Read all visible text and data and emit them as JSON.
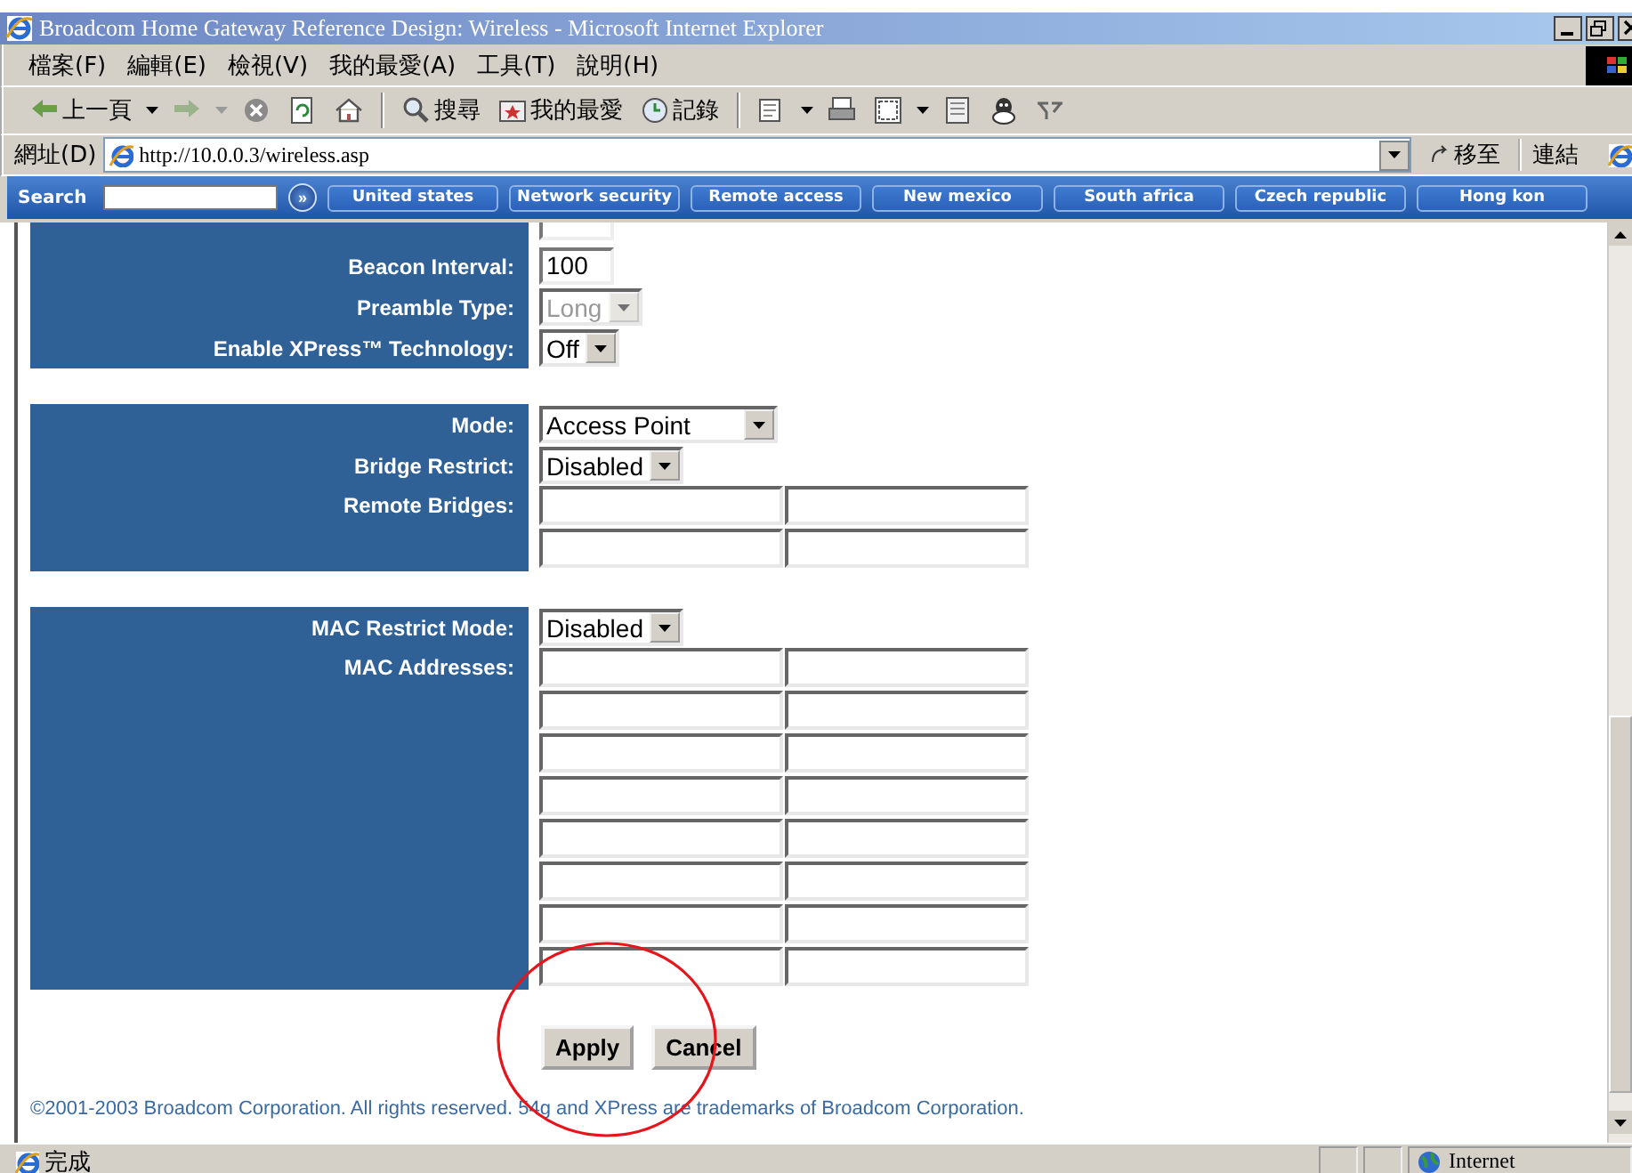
{
  "window": {
    "title": "Broadcom Home Gateway Reference Design: Wireless - Microsoft Internet Explorer"
  },
  "menu": [
    "檔案(F)",
    "編輯(E)",
    "檢視(V)",
    "我的最愛(A)",
    "工具(T)",
    "說明(H)"
  ],
  "toolbar": [
    {
      "kind": "back",
      "label": "上一頁"
    },
    {
      "kind": "forward"
    },
    {
      "kind": "stop"
    },
    {
      "kind": "refresh"
    },
    {
      "kind": "home"
    },
    {
      "kind": "search",
      "label": "搜尋"
    },
    {
      "kind": "favorites",
      "label": "我的最愛"
    },
    {
      "kind": "history",
      "label": "記錄"
    },
    {
      "kind": "mail"
    },
    {
      "kind": "print"
    },
    {
      "kind": "edit"
    },
    {
      "kind": "discuss"
    },
    {
      "kind": "messenger"
    },
    {
      "kind": "yahoo"
    }
  ],
  "address_bar": {
    "label": "網址(D)",
    "url": "http://10.0.0.3/wireless.asp",
    "go": "移至",
    "links": "連結"
  },
  "search_bar": {
    "label": "Search",
    "go": "»",
    "links": [
      "United states",
      "Network security",
      "Remote access",
      "New mexico",
      "South africa",
      "Czech republic",
      "Hong kon"
    ]
  },
  "sections": [
    {
      "rows": [
        {
          "kind": "clipped"
        },
        {
          "kind": "text",
          "label": "Beacon Interval:",
          "value": "100"
        },
        {
          "kind": "select",
          "label": "Preamble Type:",
          "value": "Long",
          "disabled": true
        },
        {
          "kind": "select",
          "label": "Enable XPress™ Technology:",
          "value": "Off",
          "disabled": false
        }
      ]
    },
    {
      "rows": [
        {
          "kind": "select",
          "label": "Mode:",
          "value": "Access Point",
          "disabled": false
        },
        {
          "kind": "select",
          "label": "Bridge Restrict:",
          "value": "Disabled",
          "disabled": false
        },
        {
          "kind": "grid",
          "label": "Remote Bridges:",
          "field_rows": [
            {
              "kind": "pair"
            },
            {
              "kind": "pair"
            }
          ]
        }
      ]
    },
    {
      "rows": [
        {
          "kind": "select",
          "label": "MAC Restrict Mode:",
          "value": "Disabled",
          "disabled": false
        },
        {
          "kind": "grid",
          "label": "MAC Addresses:",
          "field_rows": [
            {
              "kind": "pair"
            },
            {
              "kind": "pair"
            },
            {
              "kind": "pair"
            },
            {
              "kind": "pair"
            },
            {
              "kind": "pair"
            },
            {
              "kind": "pair"
            },
            {
              "kind": "pair"
            },
            {
              "kind": "pair"
            }
          ]
        }
      ]
    }
  ],
  "buttons": [
    "Apply",
    "Cancel"
  ],
  "footer": "©2001-2003 Broadcom Corporation. All rights reserved. 54g and XPress are trademarks of Broadcom Corporation.",
  "status_bar": {
    "text": "完成",
    "zone": "Internet"
  }
}
